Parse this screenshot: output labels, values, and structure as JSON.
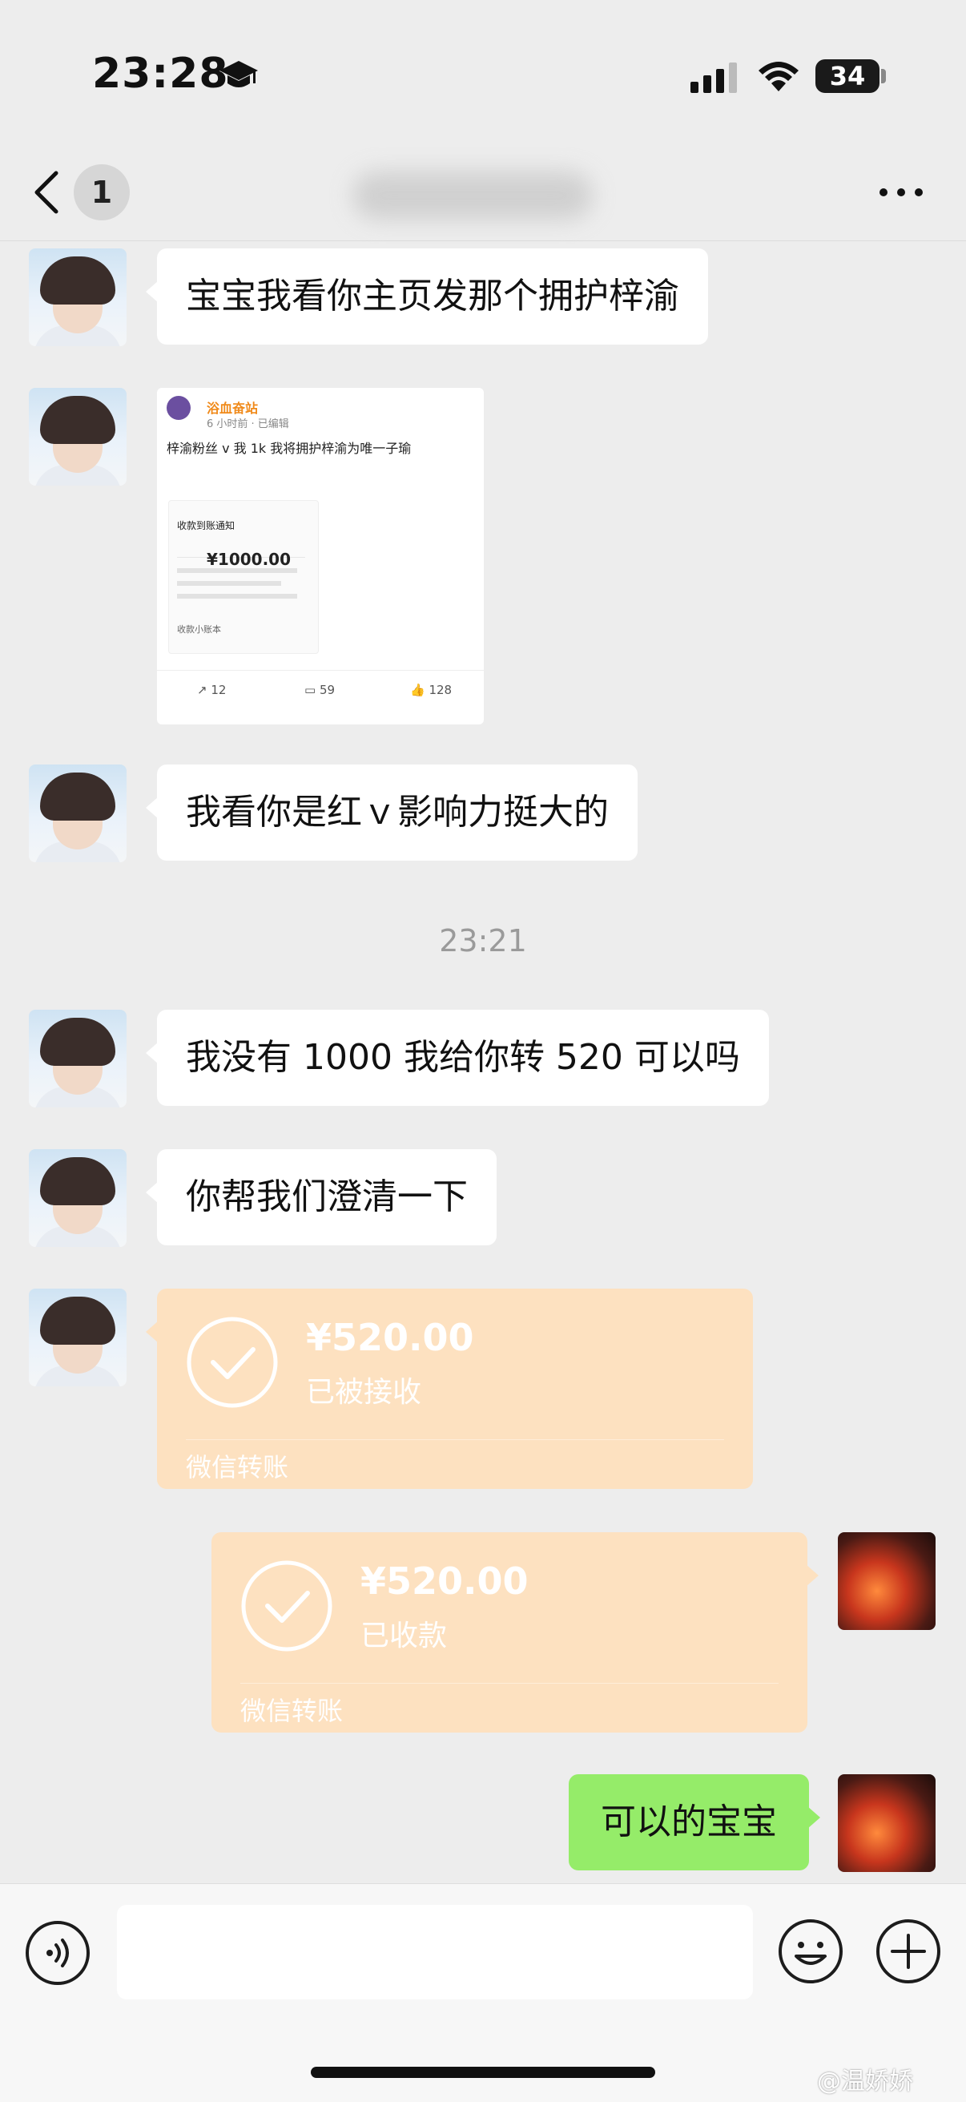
{
  "status_bar": {
    "time": "23:28",
    "battery": "34"
  },
  "nav": {
    "unread_count": "1"
  },
  "messages": {
    "m1": "宝宝我看你主页发那个拥护梓渝",
    "m3": "我看你是红ｖ影响力挺大的",
    "m4": "我没有 1000 我给你转 520 可以吗",
    "m5": "你帮我们澄清一下",
    "m8": "可以的宝宝"
  },
  "timestamp": "23:21",
  "screenshot_post": {
    "username": "浴血奋站",
    "meta": "6 小时前 · 已编辑",
    "post_text": "梓渝粉丝 v 我 1k 我将拥护梓渝为唯一子瑜",
    "card_title": "收款到账通知",
    "amount": "¥1000.00",
    "card_footer": "收款小账本",
    "reposts": "12",
    "comments": "59",
    "likes": "128"
  },
  "transfers": {
    "left": {
      "amount": "¥520.00",
      "status": "已被接收",
      "label": "微信转账"
    },
    "right": {
      "amount": "¥520.00",
      "status": "已收款",
      "label": "微信转账"
    }
  },
  "input": {
    "placeholder": ""
  },
  "watermark": "@温娇娇"
}
